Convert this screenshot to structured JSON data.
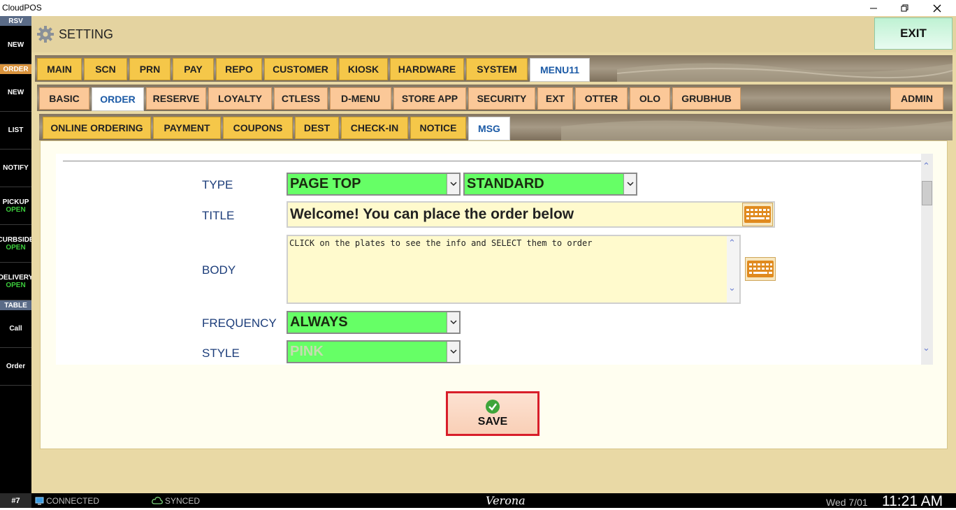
{
  "window": {
    "title": "CloudPOS"
  },
  "sidebar": {
    "rsv_label": "RSV",
    "order_label": "ORDER",
    "table_label": "TABLE",
    "new_label": "NEW",
    "order_new_label": "NEW",
    "list_label": "LIST",
    "notify_label": "NOTIFY",
    "pickup": {
      "label": "PICKUP",
      "status": "OPEN"
    },
    "curbside": {
      "label": "CURBSIDE",
      "status": "OPEN"
    },
    "delivery": {
      "label": "DELIVERY",
      "status": "OPEN"
    },
    "call_label": "Call",
    "table_order_label": "Order"
  },
  "header": {
    "title": "SETTING",
    "exit_label": "EXIT"
  },
  "tabs_main": [
    "MAIN",
    "SCN",
    "PRN",
    "PAY",
    "REPO",
    "CUSTOMER",
    "KIOSK",
    "HARDWARE",
    "SYSTEM",
    "MENU11"
  ],
  "tabs_sub": [
    "BASIC",
    "ORDER",
    "RESERVE",
    "LOYALTY",
    "CTLESS",
    "D-MENU",
    "STORE APP",
    "SECURITY",
    "EXT",
    "OTTER",
    "OLO",
    "GRUBHUB"
  ],
  "tabs_sub_admin": "ADMIN",
  "tabs_order": [
    "ONLINE ORDERING",
    "PAYMENT",
    "COUPONS",
    "DEST",
    "CHECK-IN",
    "NOTICE",
    "MSG"
  ],
  "form": {
    "type_label": "TYPE",
    "type_value": "PAGE TOP",
    "type2_value": "STANDARD",
    "title_label": "TITLE",
    "title_value": "Welcome! You can place the order below",
    "body_label": "BODY",
    "body_value": "CLICK on the plates to see the info and SELECT them to order",
    "frequency_label": "FREQUENCY",
    "frequency_value": "ALWAYS",
    "style_label": "STYLE",
    "style_value": "PINK",
    "save_label": "SAVE"
  },
  "status": {
    "station": "#7",
    "connection": "CONNECTED",
    "sync": "SYNCED",
    "store": "Verona",
    "date": "Wed 7/01",
    "time": "11:21 AM"
  },
  "colors": {
    "accent_green": "#66ff66",
    "tab_yellow": "#f5c749",
    "tab_peach": "#fbc898",
    "save_border": "#d81e2a",
    "active_tab_text": "#1b5aa6"
  }
}
